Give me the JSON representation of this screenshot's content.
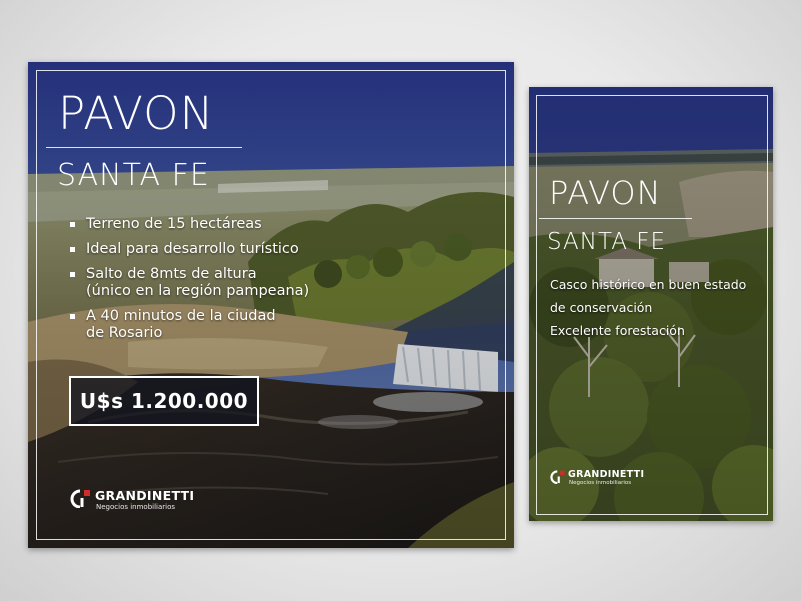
{
  "flyer_main": {
    "title": "PAVON",
    "subtitle": "SANTA FE",
    "features": [
      {
        "line1": "Terreno de 15 hectáreas",
        "line2": ""
      },
      {
        "line1": "Ideal para desarrollo turístico",
        "line2": ""
      },
      {
        "line1": "Salto de 8mts de altura",
        "line2": "(único en la región pampeana)"
      },
      {
        "line1": "A 40 minutos de la ciudad",
        "line2": "de Rosario"
      }
    ],
    "price": "U$s 1.200.000",
    "logo": {
      "name": "GRANDINETTI",
      "tagline": "Negocios inmobiliarios"
    }
  },
  "flyer_secondary": {
    "title": "PAVON",
    "subtitle": "SANTA FE",
    "features": [
      "Casco histórico en buen estado",
      "de conservación",
      "Excelente forestación"
    ],
    "logo": {
      "name": "GRANDINETTI",
      "tagline": "Negocios inmobiliarios"
    }
  },
  "colors": {
    "sky_top": "#2b3a7e",
    "brand_red": "#d32a2a",
    "water": "#2b2520"
  }
}
